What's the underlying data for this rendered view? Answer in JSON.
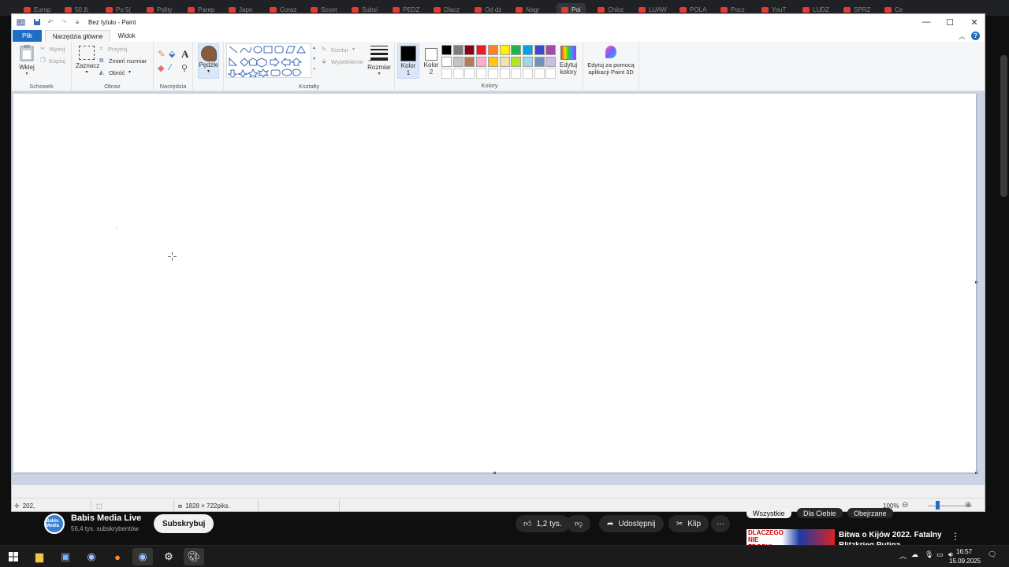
{
  "browser_tabs": [
    "Europ",
    "50 ži",
    "Po 5(",
    "Polity",
    "Parep",
    "Japo",
    "Coraz",
    "Scoot",
    "Subsi",
    "PEDZ",
    "Dlacz",
    "Od dz",
    "Nagr",
    "Poi",
    "Chloc",
    "LUAW",
    "POLA",
    "Pocz",
    "YouT",
    "LUDZ",
    "SPRZ",
    "Ce"
  ],
  "paint": {
    "window_title": "Bez tytułu - Paint",
    "tabs": {
      "file": "Plik",
      "home": "Narzędzia główne",
      "view": "Widok"
    },
    "clipboard": {
      "paste": "Wklej",
      "cut": "Wytnij",
      "copy": "Kopiuj",
      "label": "Schowek"
    },
    "image": {
      "select": "Zaznacz",
      "crop": "Przytnij",
      "resize": "Zmień rozmiar",
      "rotate": "Obróć",
      "label": "Obraz"
    },
    "tools": {
      "label": "Narzędzia",
      "brushes": "Pędzle"
    },
    "shapes": {
      "label": "Kształty",
      "outline": "Kontur",
      "fill": "Wypełnienie"
    },
    "size": "Rozmiar",
    "color1": {
      "line1": "Kolor",
      "line2": "1"
    },
    "color2": {
      "line1": "Kolor",
      "line2": "2"
    },
    "edit_colors": {
      "line1": "Edytuj",
      "line2": "kolory"
    },
    "paint3d": {
      "line1": "Edytuj za pomocą",
      "line2": "aplikacji Paint 3D"
    },
    "colors_label": "Kolory",
    "palette_row1": [
      "#000000",
      "#7f7f7f",
      "#880015",
      "#ed1c24",
      "#ff7f27",
      "#fff200",
      "#22b14c",
      "#00a2e8",
      "#3f48cc",
      "#a349a4"
    ],
    "palette_row2": [
      "#ffffff",
      "#c3c3c3",
      "#b97a57",
      "#ffaec9",
      "#ffc90e",
      "#efe4b0",
      "#b5e61d",
      "#99d9ea",
      "#7092be",
      "#c8bfe7"
    ],
    "status": {
      "position": "202,",
      "dimensions": "1828 × 722piks.",
      "zoom": "100%"
    }
  },
  "youtube": {
    "channel_name": "Babis Media Live",
    "subscribers": "56,4 tys. subskrybentów",
    "avatar_text": "Babis Media",
    "subscribe": "Subskrybuj",
    "likes": "1,2 tys.",
    "share": "Udostępnij",
    "clip": "Klip",
    "chips": [
      "Wszystkie",
      "Dla Ciebie",
      "Obejrzane"
    ],
    "recommended_title": "Bitwa o Kijów 2022. Fatalny",
    "recommended_sub": "Blitzkrieg Putina",
    "thumb_text": "DLACZEGO NIE ZDOBYŁ"
  },
  "taskbar": {
    "time": "16:57",
    "date": "15.09.2025"
  }
}
